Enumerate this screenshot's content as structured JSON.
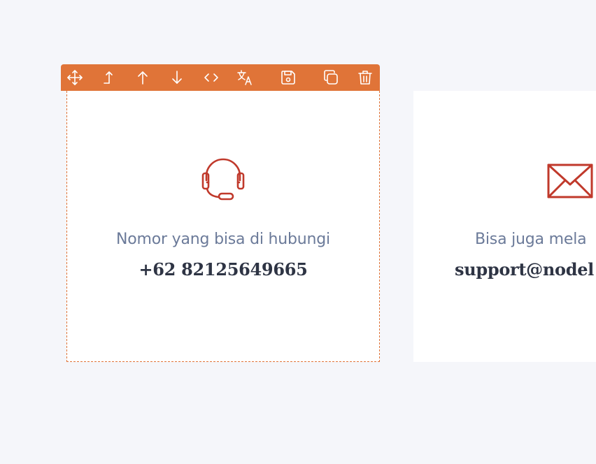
{
  "toolbar": {
    "color": "#e07438",
    "buttons": [
      {
        "icon": "move-icon"
      },
      {
        "icon": "select-parent-icon"
      },
      {
        "icon": "move-up-icon"
      },
      {
        "icon": "move-down-icon"
      },
      {
        "icon": "code-icon"
      },
      {
        "icon": "translate-icon"
      },
      {
        "icon": "save-icon"
      },
      {
        "icon": "duplicate-icon"
      },
      {
        "icon": "delete-icon"
      }
    ]
  },
  "cards": [
    {
      "icon": "headset-icon",
      "label": "Nomor yang bisa di hubungi",
      "value": "+62 82125649665"
    },
    {
      "icon": "envelope-icon",
      "label": "Bisa juga mela",
      "value": "support@nodel"
    }
  ],
  "colors": {
    "accent": "#e07438",
    "icon": "#c0392b",
    "label": "#6b7a99",
    "value": "#2e3444",
    "background": "#f5f6fa"
  }
}
